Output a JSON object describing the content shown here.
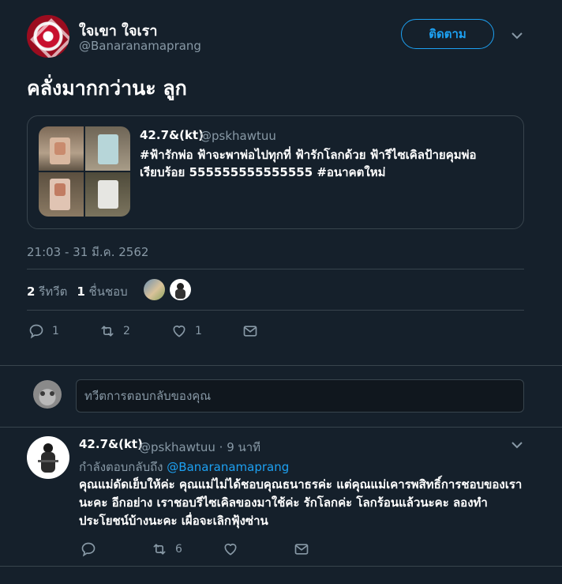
{
  "tweet": {
    "author_name": "ใจเขา ใจเรา",
    "author_handle": "@Banaranamaprang",
    "follow_label": "ติดตาม",
    "text": "คลั่งมากกว่านะ ลูก",
    "timestamp": "21:03 - 31 มี.ค. 2562",
    "retweets_count": "2",
    "retweets_label": "รีทวีต",
    "likes_count": "1",
    "likes_label": "ชื่นชอบ",
    "actions": {
      "reply_count": "1",
      "retweet_count": "2",
      "like_count": "1"
    }
  },
  "quoted": {
    "name": "42.7&(kt)",
    "handle": "@pskhawtuu",
    "text": "#ฟ้ารักพ่อ ฟ้าจะพาพ่อไปทุกที่ ฟ้ารักโลกด้วย ฟ้ารีไซเคิลป้ายคุมพ่อเรียบร้อย 555555555555555 #อนาคตใหม่"
  },
  "reply_box": {
    "placeholder": "ทวีตการตอบกลับของคุณ"
  },
  "reply": {
    "name": "42.7&(kt)",
    "meta": "@pskhawtuu · 9 นาที",
    "replying_prefix": "กำลังตอบกลับถึง",
    "replying_handle": "@Banaranamaprang",
    "text": "คุณแม่ดัดเย็บให้ค่ะ คุณแม่ไม่ได้ชอบคุณธนาธรค่ะ แต่คุณแม่เคารพสิทธิ์การชอบของเรานะคะ อีกอย่าง เราชอบรีไซเคิลของมาใช้ค่ะ รักโลกค่ะ โลกร้อนแล้วนะคะ ลองทำประโยชน์บ้างนะคะ เผื่อจะเลิกฟุ้งซ่าน",
    "actions": {
      "retweet_count": "6"
    }
  },
  "colors": {
    "background": "#15202b",
    "accent": "#1da1f2",
    "muted": "#8899a6",
    "border": "#38444d"
  }
}
